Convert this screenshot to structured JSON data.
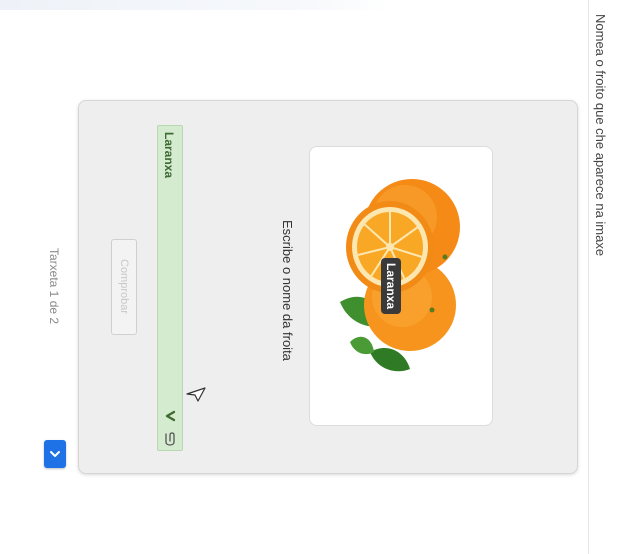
{
  "task": {
    "instruction": "Nomea o froito que che aparece na imaxe"
  },
  "card": {
    "image_label": "Laranxa",
    "prompt": "Escribe o nome da froita",
    "answer_value": "Laranxa",
    "check_button_label": "Comprobar"
  },
  "footer": {
    "pager": "Tarxeta 1 de 2"
  },
  "icons": {
    "check": "check-icon",
    "clip": "paperclip-icon",
    "dropdown": "chevron-down-icon",
    "cursor": "mouse-pointer-icon"
  },
  "colors": {
    "answer_bg": "#d4ebcf",
    "answer_text": "#3d6b33",
    "accent": "#1e72e6",
    "orange": "#f7941d"
  }
}
